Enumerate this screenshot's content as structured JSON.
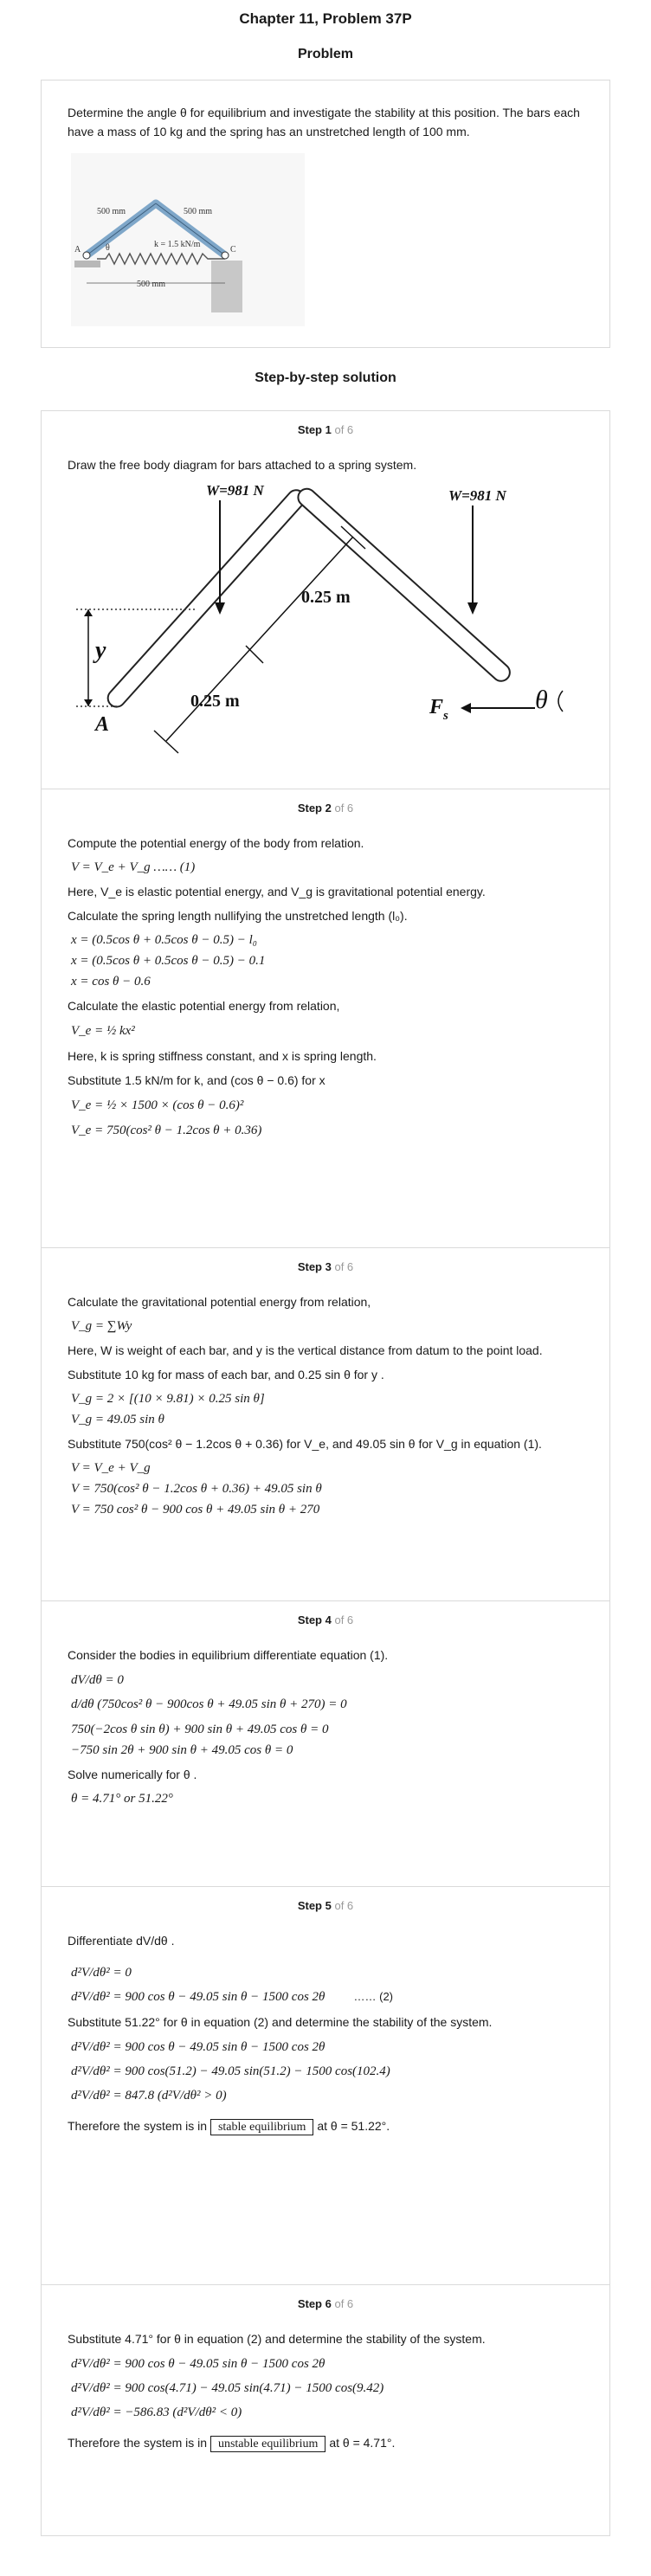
{
  "header": {
    "title": "Chapter 11, Problem 37P",
    "problem_heading": "Problem"
  },
  "problem": {
    "statement": "Determine the angle θ for equilibrium and investigate the stability at this position. The bars each have a mass of 10 kg and the spring has an unstretched length of 100 mm.",
    "figure": {
      "label_left": "500 mm",
      "label_right": "500 mm",
      "label_k": "k = 1.5 kN/m",
      "label_theta": "θ",
      "label_A": "A",
      "label_C": "C",
      "label_base": "500 mm"
    }
  },
  "solution_heading": "Step-by-step solution",
  "steps": [
    {
      "label": "Step 1",
      "of": "of 6",
      "text": "Draw the free body diagram for bars attached to a spring system.",
      "fbd": {
        "w_left": "W=981 N",
        "w_right": "W=981 N",
        "len_top": "0.25 m",
        "len_bottom": "0.25 m",
        "y": "y",
        "A": "A",
        "Fs": "F",
        "Fs_sub": "s",
        "theta": "θ"
      }
    },
    {
      "label": "Step 2",
      "of": "of 6",
      "t1": "Compute the potential energy of the body from relation.",
      "e1": "V = V_e + V_g …… (1)",
      "t2": "Here, V_e is elastic potential energy, and V_g is gravitational potential energy.",
      "t3": "Calculate the spring length nullifying the unstretched length (l₀).",
      "e2": "x = (0.5cos θ + 0.5cos θ − 0.5) − l₀",
      "e3": "x = (0.5cos θ + 0.5cos θ − 0.5) − 0.1",
      "e4": "x = cos θ − 0.6",
      "t4": "Calculate the elastic potential energy from relation,",
      "e5": "V_e = ½ kx²",
      "t5": "Here, k is spring stiffness constant, and x is spring length.",
      "t6": "Substitute 1.5 kN/m for k, and (cos θ − 0.6) for x",
      "e6": "V_e = ½ × 1500 × (cos θ − 0.6)²",
      "e7": "V_e = 750(cos² θ − 1.2cos θ + 0.36)"
    },
    {
      "label": "Step 3",
      "of": "of 6",
      "t1": "Calculate the gravitational potential energy from relation,",
      "e1": "V_g = ∑Wy",
      "t2": "Here, W is weight of each bar, and y is the vertical distance from datum to the point load.",
      "t3": "Substitute 10 kg for mass of each bar, and 0.25 sin θ for y .",
      "e2": "V_g = 2 × [(10 × 9.81) × 0.25 sin θ]",
      "e3": "V_g = 49.05 sin θ",
      "t4": "Substitute 750(cos² θ − 1.2cos θ + 0.36) for V_e, and 49.05 sin θ for V_g in equation (1).",
      "e4": "V = V_e + V_g",
      "e5": "V = 750(cos² θ − 1.2cos θ + 0.36) + 49.05 sin θ",
      "e6": "V = 750 cos² θ − 900 cos θ + 49.05 sin θ + 270"
    },
    {
      "label": "Step 4",
      "of": "of 6",
      "t1": "Consider the bodies in equilibrium differentiate equation (1).",
      "e1": "dV/dθ = 0",
      "e2": "d/dθ (750cos² θ − 900cos θ + 49.05 sin θ + 270) = 0",
      "e3": "750(−2cos θ sin θ) + 900 sin θ + 49.05 cos θ = 0",
      "e4": "−750 sin 2θ + 900 sin θ + 49.05 cos θ = 0",
      "t2": "Solve numerically for θ .",
      "e5": "θ = 4.71° or 51.22°"
    },
    {
      "label": "Step 5",
      "of": "of 6",
      "t1": "Differentiate dV/dθ .",
      "e1": "d²V/dθ² = 0",
      "e2": "d²V/dθ² = 900 cos θ − 49.05 sin θ − 1500 cos 2θ",
      "tag": "…… (2)",
      "t2": "Substitute 51.22° for θ in equation (2) and determine the stability of the system.",
      "e3": "d²V/dθ² = 900 cos θ − 49.05 sin θ − 1500 cos 2θ",
      "e4": "d²V/dθ² = 900 cos(51.2) − 49.05 sin(51.2) − 1500 cos(102.4)",
      "e5": "d²V/dθ² = 847.8 (d²V/dθ² > 0)",
      "t3": "Therefore the system is in",
      "boxed": "stable equilibrium",
      "t4": "at θ = 51.22°."
    },
    {
      "label": "Step 6",
      "of": "of 6",
      "t1": "Substitute 4.71° for θ in equation (2) and determine the stability of the system.",
      "e1": "d²V/dθ² = 900 cos θ − 49.05 sin θ − 1500 cos 2θ",
      "e2": "d²V/dθ² = 900 cos(4.71) − 49.05 sin(4.71) − 1500 cos(9.42)",
      "e3": "d²V/dθ² = −586.83 (d²V/dθ² < 0)",
      "t2": "Therefore the system is in",
      "boxed": "unstable equilibrium",
      "t3": "at θ = 4.71°."
    }
  ]
}
